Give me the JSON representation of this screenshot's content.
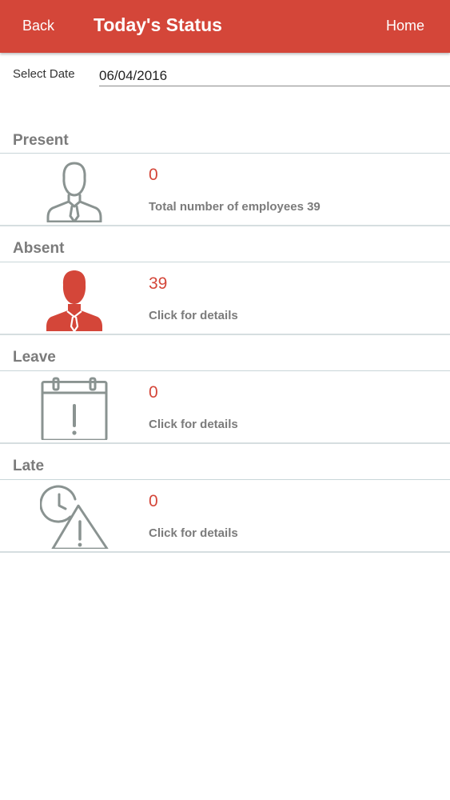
{
  "header": {
    "back_label": "Back",
    "title": "Today's Status",
    "home_label": "Home"
  },
  "date_picker": {
    "label": "Select Date",
    "value": "06/04/2016"
  },
  "sections": {
    "present": {
      "title": "Present",
      "count": "0",
      "subtitle": "Total number of employees 39",
      "icon": "employee-outline-icon"
    },
    "absent": {
      "title": "Absent",
      "count": "39",
      "subtitle": "Click for details",
      "icon": "employee-filled-icon"
    },
    "leave": {
      "title": "Leave",
      "count": "0",
      "subtitle": "Click for details",
      "icon": "calendar-alert-icon"
    },
    "late": {
      "title": "Late",
      "count": "0",
      "subtitle": "Click for details",
      "icon": "clock-warning-icon"
    }
  },
  "colors": {
    "accent": "#d44639",
    "icon_gray": "#8a9391",
    "section_text": "#7b7b7b"
  }
}
